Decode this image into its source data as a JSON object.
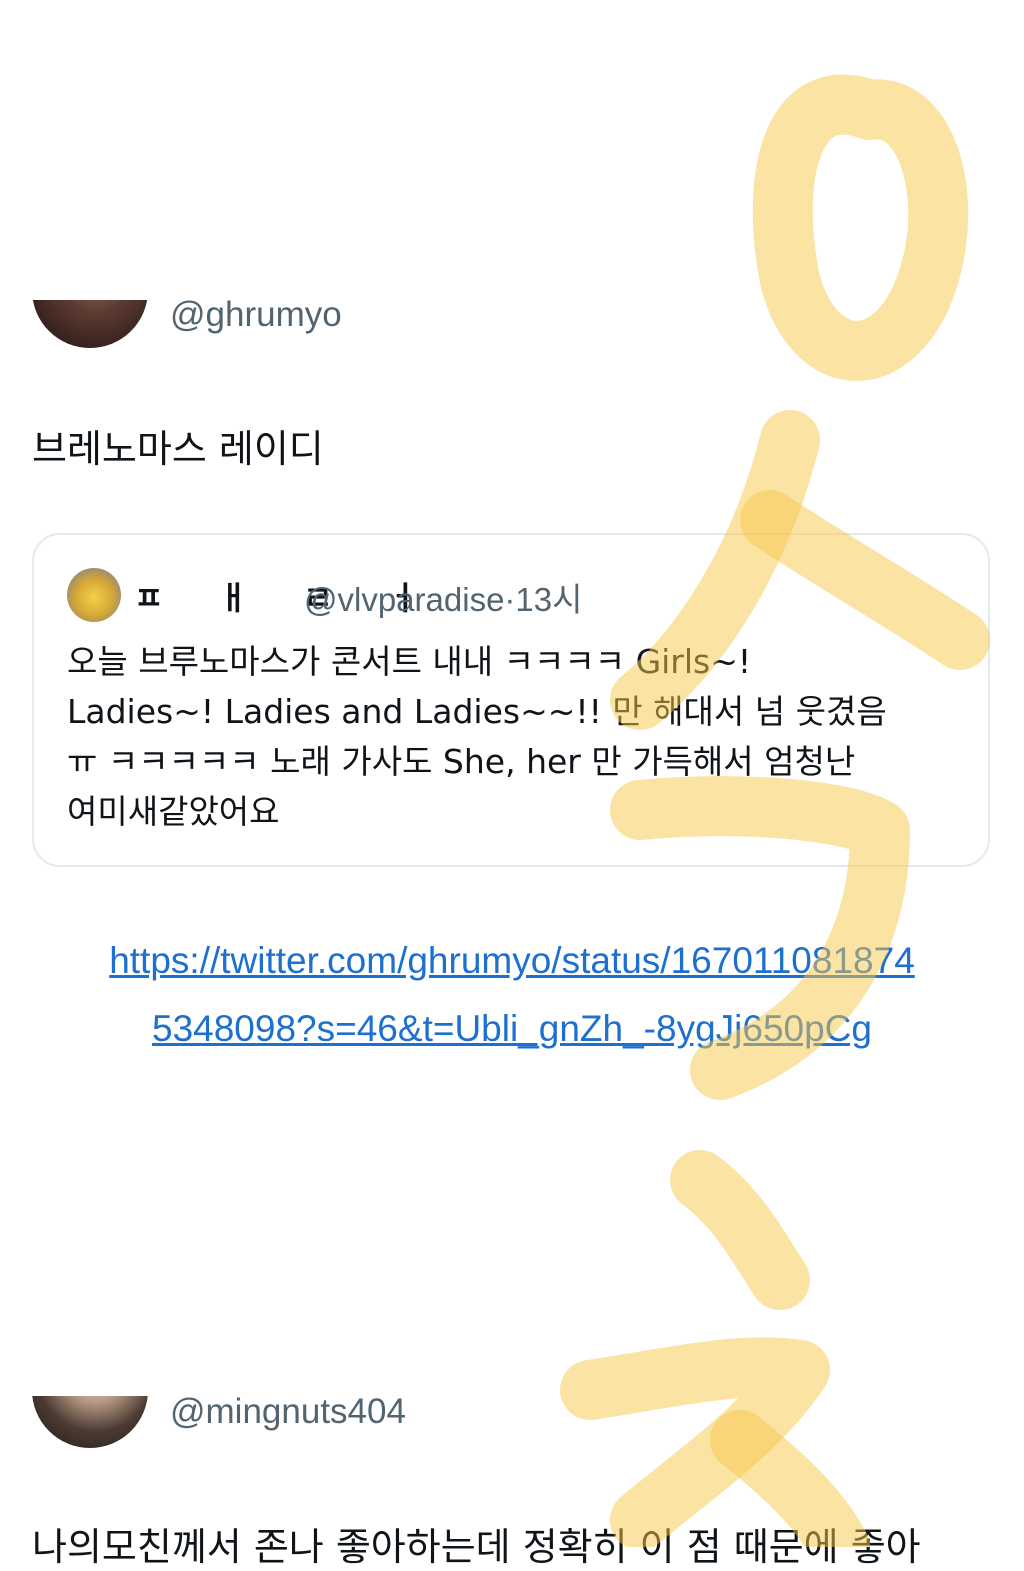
{
  "post1": {
    "handle": "@ghrumyo",
    "text": "브레노마스 레이디",
    "quote": {
      "name": "ㅍ ㅐ ㄹ ㅓ",
      "handle": "@vlvparadise",
      "separator": "·",
      "time": "13시",
      "lines": [
        "오늘 브루노마스가 콘서트 내내 ㅋㅋㅋㅋ Girls~!",
        "Ladies~! Ladies and Ladies~~!! 만 해대서 넘 웃겼음",
        "ㅠ ㅋㅋㅋㅋㅋ 노래 가사도 She, her 만 가득해서 엄청난",
        "여미새같았어요"
      ]
    },
    "link_lines": [
      "https://twitter.com/ghrumyo/status/167011081874",
      "5348098?s=46&t=Ubli_gnZh_-8ygJj650pCg"
    ]
  },
  "post2": {
    "handle": "@mingnuts404",
    "text": "나의모친께서 존나 좋아하는데 정확히 이 점 때문에 좋아"
  },
  "watermark": {
    "text": "어스크",
    "color": "#f7c84a"
  }
}
